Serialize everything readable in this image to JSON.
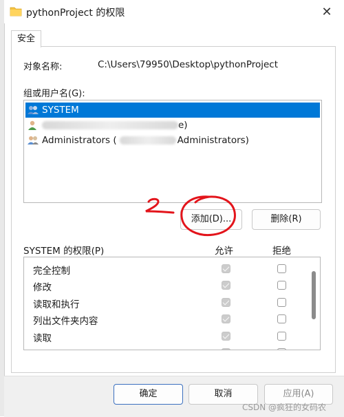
{
  "window": {
    "title": "pythonProject 的权限",
    "icons": {
      "folder": "folder-icon",
      "close": "close-icon"
    }
  },
  "tabs": [
    {
      "label": "安全",
      "active": true
    }
  ],
  "object_name": {
    "label": "对象名称:",
    "value": "C:\\Users\\79950\\Desktop\\pythonProject"
  },
  "groups": {
    "label": "组或用户名(G):",
    "items": [
      {
        "name": "SYSTEM",
        "selected": true,
        "icon": "users-group-icon"
      },
      {
        "name": "",
        "suffix": "e)",
        "icon": "user-icon",
        "redacted": true
      },
      {
        "name": "Administrators (",
        "suffix": "Administrators)",
        "icon": "users-group-icon",
        "redacted": true
      }
    ]
  },
  "buttons": {
    "add": "添加(D)...",
    "remove": "删除(R)",
    "ok": "确定",
    "cancel": "取消",
    "apply": "应用(A)"
  },
  "permissions": {
    "label": "SYSTEM 的权限(P)",
    "allow_header": "允许",
    "deny_header": "拒绝",
    "rows": [
      {
        "name": "完全控制",
        "allow": true,
        "deny": false
      },
      {
        "name": "修改",
        "allow": true,
        "deny": false
      },
      {
        "name": "读取和执行",
        "allow": true,
        "deny": false
      },
      {
        "name": "列出文件夹内容",
        "allow": true,
        "deny": false
      },
      {
        "name": "读取",
        "allow": true,
        "deny": false
      },
      {
        "name": "写入",
        "allow": true,
        "deny": false
      }
    ]
  },
  "annotation": {
    "mark": "2"
  },
  "watermark": "CSDN @疯狂的女码农"
}
